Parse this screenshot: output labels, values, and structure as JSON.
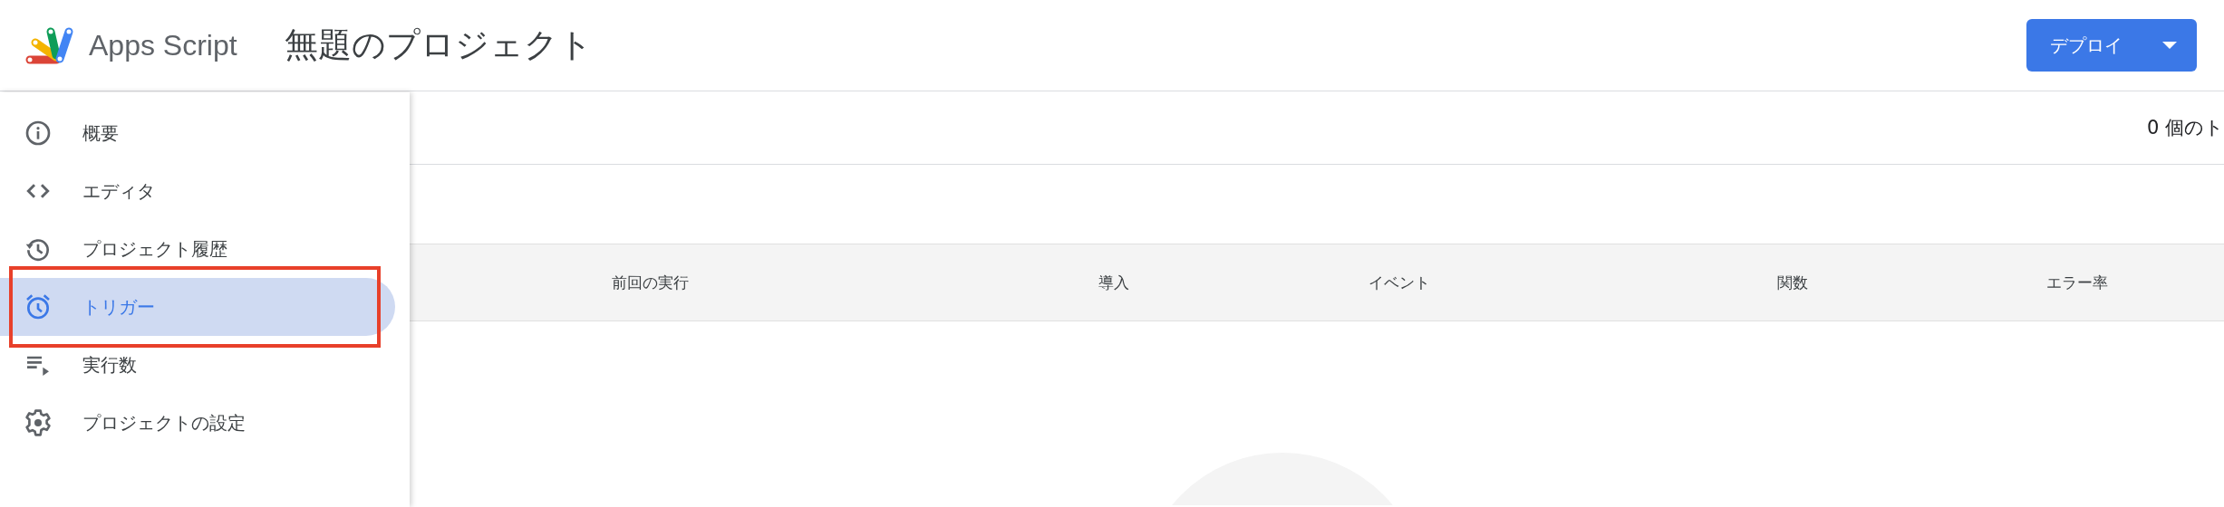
{
  "header": {
    "product_name": "Apps Script",
    "project_title": "無題のプロジェクト",
    "deploy_button": {
      "label": "デプロイ"
    }
  },
  "sidebar": {
    "items": [
      {
        "label": "概要",
        "selected": false,
        "highlighted": false
      },
      {
        "label": "エディタ",
        "selected": false,
        "highlighted": false
      },
      {
        "label": "プロジェクト履歴",
        "selected": false,
        "highlighted": false
      },
      {
        "label": "トリガー",
        "selected": true,
        "highlighted": true
      },
      {
        "label": "実行数",
        "selected": false,
        "highlighted": false
      },
      {
        "label": "プロジェクトの設定",
        "selected": false,
        "highlighted": false
      }
    ]
  },
  "toolbar": {
    "trigger_count": "0 個のト"
  },
  "table": {
    "columns": [
      "前回の実行",
      "導入",
      "イベント",
      "関数",
      "エラー率"
    ]
  }
}
